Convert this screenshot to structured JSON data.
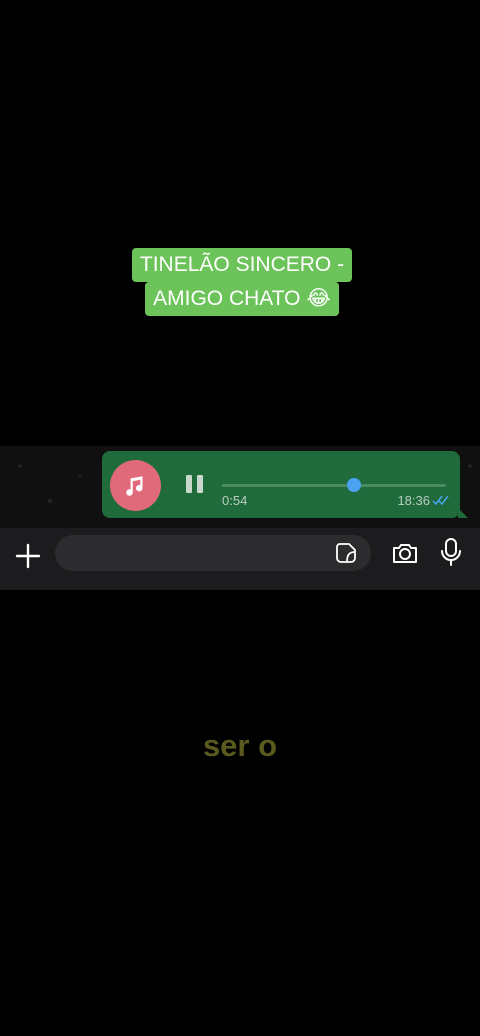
{
  "title": {
    "line1": "TINELÃO SINCERO -",
    "line2": "AMIGO CHATO 😂"
  },
  "audio_message": {
    "duration": "0:54",
    "timestamp": "18:36",
    "progress": 0.59,
    "status_icon": "double-check-icon",
    "colors": {
      "bubble": "#1f6b3b",
      "music_circle": "#e06a7a",
      "knob": "#4aa3f0"
    }
  },
  "composer": {
    "text_value": "",
    "icons": [
      "plus-icon",
      "sticker-icon",
      "camera-icon",
      "microphone-icon"
    ]
  },
  "caption": "ser o"
}
